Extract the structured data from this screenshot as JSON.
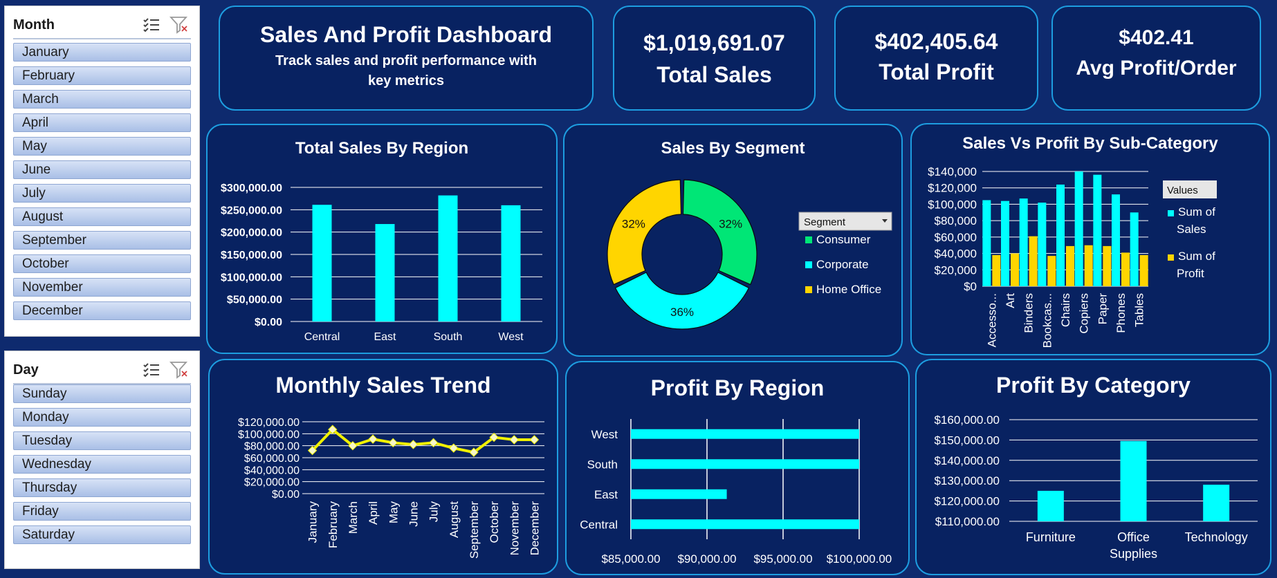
{
  "slicers": {
    "month": {
      "title": "Month",
      "items": [
        "January",
        "February",
        "March",
        "April",
        "May",
        "June",
        "July",
        "August",
        "September",
        "October",
        "November",
        "December"
      ]
    },
    "day": {
      "title": "Day",
      "items": [
        "Sunday",
        "Monday",
        "Tuesday",
        "Wednesday",
        "Thursday",
        "Friday",
        "Saturday"
      ]
    }
  },
  "header": {
    "title": "Sales And Profit Dashboard",
    "subtitle": "Track sales and profit performance with key metrics"
  },
  "kpis": {
    "sales": {
      "value": "$1,019,691.07",
      "label": "Total Sales"
    },
    "profit": {
      "value": "$402,405.64",
      "label": "Total Profit"
    },
    "avg": {
      "value": "$402.41",
      "label": "Avg Profit/Order"
    }
  },
  "colors": {
    "background": "#0e2a6e",
    "card": "#082261",
    "border": "#1d9de0",
    "cyan": "#00ffff",
    "yellow": "#ffd500",
    "green": "#00e676",
    "trend": "#f0f000"
  },
  "chart_data": [
    {
      "id": "region_sales",
      "type": "bar",
      "title": "Total Sales By Region",
      "categories": [
        "Central",
        "East",
        "South",
        "West"
      ],
      "values": [
        261000,
        218000,
        282000,
        260000
      ],
      "ylim": [
        0,
        300000
      ],
      "yticks": [
        "$0.00",
        "$50,000.00",
        "$100,000.00",
        "$150,000.00",
        "$200,000.00",
        "$250,000.00",
        "$300,000.00"
      ],
      "grid": true
    },
    {
      "id": "segment",
      "type": "pie",
      "title": "Sales By Segment",
      "legend_title": "Segment",
      "legend_position": "right",
      "slices": [
        {
          "name": "Consumer",
          "value": 32,
          "label": "32%"
        },
        {
          "name": "Corporate",
          "value": 36,
          "label": "36%"
        },
        {
          "name": "Home Office",
          "value": 32,
          "label": "32%"
        }
      ]
    },
    {
      "id": "subcat",
      "type": "bar",
      "title": "Sales Vs Profit By Sub-Category",
      "legend_title": "Values",
      "legend_position": "right",
      "categories": [
        "Accesso...",
        "Art",
        "Binders",
        "Bookcas...",
        "Chairs",
        "Copiers",
        "Paper",
        "Phones",
        "Tables"
      ],
      "series": [
        {
          "name": "Sum of Sales",
          "values": [
            105000,
            104000,
            107000,
            102000,
            124000,
            140000,
            136000,
            112000,
            90000
          ]
        },
        {
          "name": "Sum of Profit",
          "values": [
            38000,
            40000,
            61000,
            37000,
            49000,
            50000,
            49000,
            41000,
            38000
          ]
        }
      ],
      "ylim": [
        0,
        140000
      ],
      "yticks": [
        "$0",
        "$20,000",
        "$40,000",
        "$60,000",
        "$80,000",
        "$100,000",
        "$120,000",
        "$140,000"
      ],
      "grid": true
    },
    {
      "id": "monthly",
      "type": "line",
      "title": "Monthly Sales Trend",
      "categories": [
        "January",
        "February",
        "March",
        "April",
        "May",
        "June",
        "July",
        "August",
        "September",
        "October",
        "November",
        "December"
      ],
      "values": [
        72000,
        107000,
        80000,
        91000,
        85000,
        82000,
        85000,
        76000,
        69000,
        94000,
        90000,
        90000
      ],
      "ylim": [
        0,
        120000
      ],
      "yticks": [
        "$0.00",
        "$20,000.00",
        "$40,000.00",
        "$60,000.00",
        "$80,000.00",
        "$100,000.00",
        "$120,000.00"
      ],
      "grid": true
    },
    {
      "id": "region_profit",
      "type": "bar",
      "orientation": "horizontal",
      "title": "Profit By Region",
      "categories": [
        "Central",
        "East",
        "South",
        "West"
      ],
      "values": [
        100000,
        91300,
        100000,
        100000
      ],
      "xlim": [
        85000,
        100000
      ],
      "xticks": [
        "$85,000.00",
        "$90,000.00",
        "$95,000.00",
        "$100,000.00"
      ],
      "grid": true
    },
    {
      "id": "category_profit",
      "type": "bar",
      "title": "Profit By Category",
      "categories": [
        "Furniture",
        "Office Supplies",
        "Technology"
      ],
      "values": [
        125000,
        149500,
        128000
      ],
      "ylim": [
        110000,
        160000
      ],
      "yticks": [
        "$110,000.00",
        "$120,000.00",
        "$130,000.00",
        "$140,000.00",
        "$150,000.00",
        "$160,000.00"
      ],
      "grid": true
    }
  ]
}
